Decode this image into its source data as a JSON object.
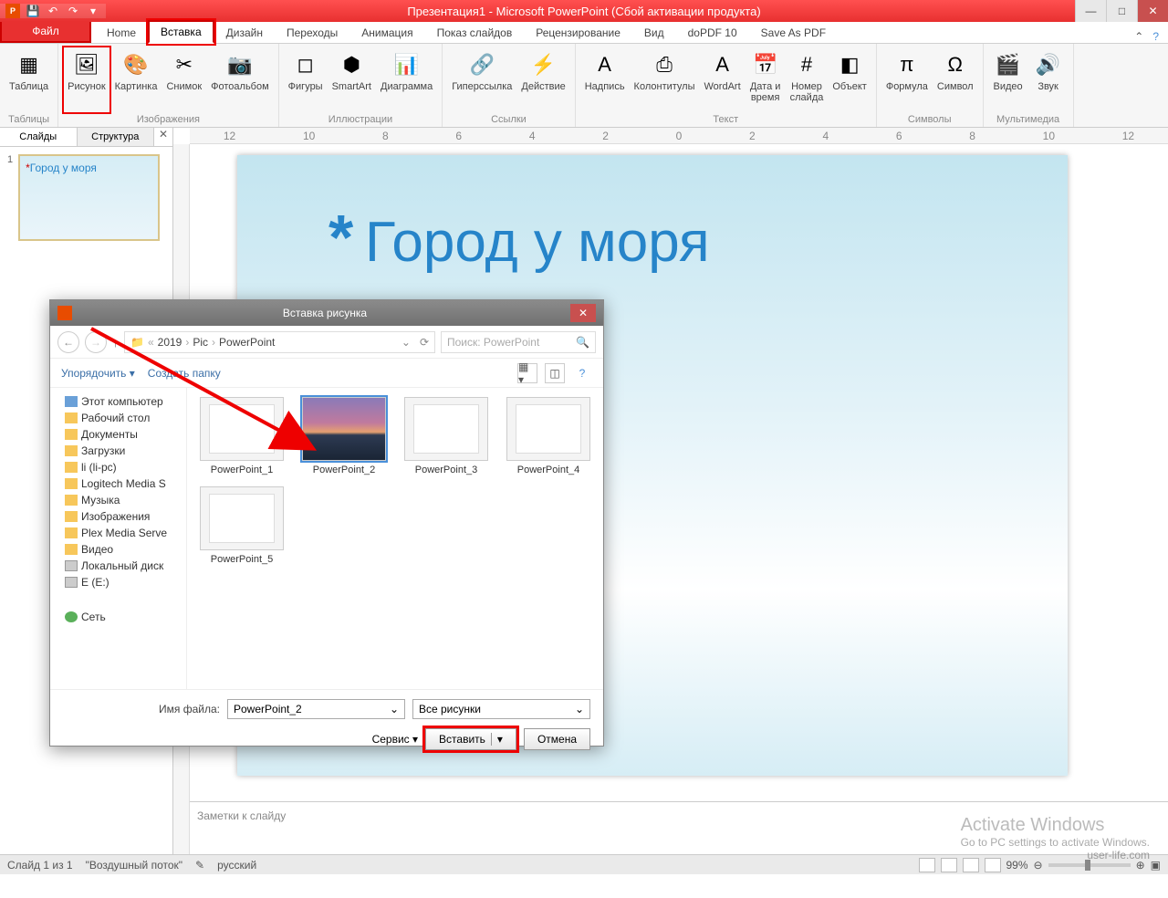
{
  "title": "Презентация1 - Microsoft PowerPoint (Сбой активации продукта)",
  "qat_icons": [
    "save",
    "undo",
    "redo",
    "print"
  ],
  "tabs": {
    "file": "Файл",
    "items": [
      "Home",
      "Вставка",
      "Дизайн",
      "Переходы",
      "Анимация",
      "Показ слайдов",
      "Рецензирование",
      "Вид",
      "doPDF 10",
      "Save As PDF"
    ],
    "active": "Вставка"
  },
  "ribbon": [
    {
      "name": "Таблицы",
      "items": [
        {
          "id": "table",
          "label": "Таблица"
        }
      ]
    },
    {
      "name": "Изображения",
      "items": [
        {
          "id": "picture",
          "label": "Рисунок",
          "hl": true
        },
        {
          "id": "clipart",
          "label": "Картинка"
        },
        {
          "id": "screenshot",
          "label": "Снимок"
        },
        {
          "id": "album",
          "label": "Фотоальбом"
        }
      ]
    },
    {
      "name": "Иллюстрации",
      "items": [
        {
          "id": "shapes",
          "label": "Фигуры"
        },
        {
          "id": "smartart",
          "label": "SmartArt"
        },
        {
          "id": "chart",
          "label": "Диаграмма"
        }
      ]
    },
    {
      "name": "Ссылки",
      "items": [
        {
          "id": "link",
          "label": "Гиперссылка"
        },
        {
          "id": "action",
          "label": "Действие"
        }
      ]
    },
    {
      "name": "Текст",
      "items": [
        {
          "id": "textbox",
          "label": "Надпись"
        },
        {
          "id": "headerfooter",
          "label": "Колонтитулы"
        },
        {
          "id": "wordart",
          "label": "WordArt"
        },
        {
          "id": "datetime",
          "label": "Дата и\nвремя"
        },
        {
          "id": "slidenum",
          "label": "Номер\nслайда"
        },
        {
          "id": "object",
          "label": "Объект"
        }
      ]
    },
    {
      "name": "Символы",
      "items": [
        {
          "id": "equation",
          "label": "Формула"
        },
        {
          "id": "symbol",
          "label": "Символ"
        }
      ]
    },
    {
      "name": "Мультимедиа",
      "items": [
        {
          "id": "video",
          "label": "Видео"
        },
        {
          "id": "audio",
          "label": "Звук"
        }
      ]
    }
  ],
  "panel_tabs": {
    "slides": "Слайды",
    "outline": "Структура"
  },
  "slide": {
    "num": "1",
    "title": "Город у моря",
    "asterisk": "*"
  },
  "notes_placeholder": "Заметки к слайду",
  "status": {
    "slide": "Слайд 1 из 1",
    "theme": "\"Воздушный поток\"",
    "lang": "русский",
    "zoom": "99%"
  },
  "dialog": {
    "title": "Вставка рисунка",
    "breadcrumb": [
      "2019",
      "Pic",
      "PowerPoint"
    ],
    "search_placeholder": "Поиск: PowerPoint",
    "organize": "Упорядочить",
    "newfolder": "Создать папку",
    "tree": [
      {
        "ic": "pc",
        "label": "Этот компьютер"
      },
      {
        "ic": "folder",
        "label": "Рабочий стол"
      },
      {
        "ic": "folder",
        "label": "Документы"
      },
      {
        "ic": "folder",
        "label": "Загрузки"
      },
      {
        "ic": "folder",
        "label": "li (li-pc)"
      },
      {
        "ic": "folder",
        "label": "Logitech Media S"
      },
      {
        "ic": "folder",
        "label": "Музыка"
      },
      {
        "ic": "folder",
        "label": "Изображения"
      },
      {
        "ic": "folder",
        "label": "Plex Media Serve"
      },
      {
        "ic": "folder",
        "label": "Видео"
      },
      {
        "ic": "drive",
        "label": "Локальный диск"
      },
      {
        "ic": "drive",
        "label": "E (E:)"
      },
      {
        "ic": "net",
        "label": "Сеть"
      }
    ],
    "files": [
      {
        "name": "PowerPoint_1",
        "sel": false,
        "kind": "doc"
      },
      {
        "name": "PowerPoint_2",
        "sel": true,
        "kind": "sunset"
      },
      {
        "name": "PowerPoint_3",
        "sel": false,
        "kind": "doc"
      },
      {
        "name": "PowerPoint_4",
        "sel": false,
        "kind": "doc"
      },
      {
        "name": "PowerPoint_5",
        "sel": false,
        "kind": "doc"
      }
    ],
    "filename_label": "Имя файла:",
    "filename_value": "PowerPoint_2",
    "filter": "Все рисунки",
    "service": "Сервис",
    "insert": "Вставить",
    "cancel": "Отмена"
  },
  "watermark": {
    "big": "Activate Windows",
    "small": "Go to PC settings to activate Windows.",
    "site": "user-life.com"
  }
}
